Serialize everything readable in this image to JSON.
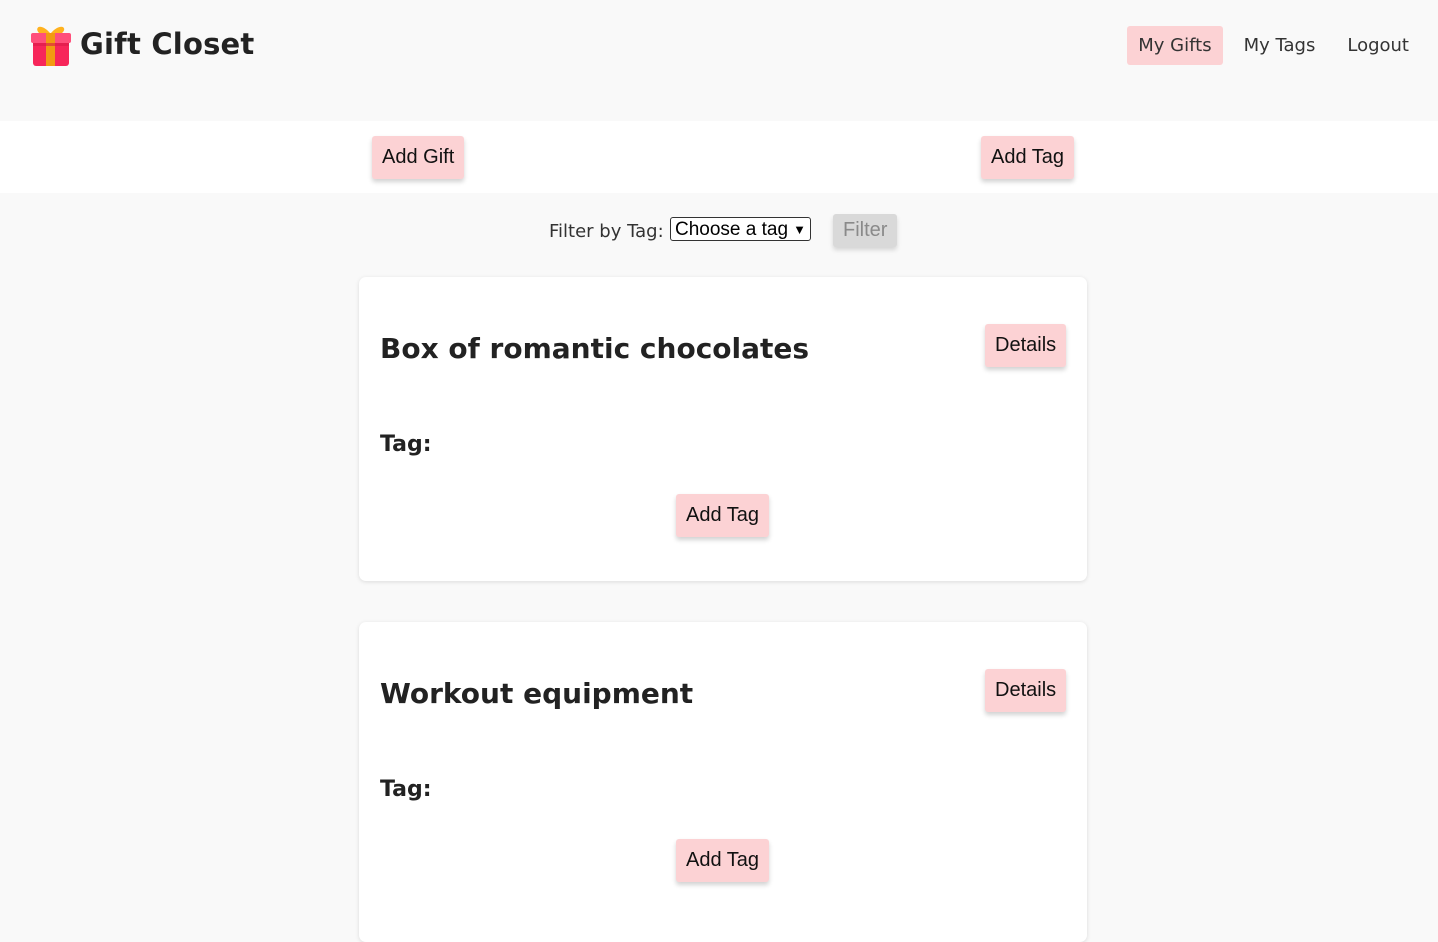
{
  "header": {
    "brand_title": "Gift Closet",
    "brand_icon": "gift-icon",
    "nav": [
      {
        "label": "My Gifts",
        "active": true
      },
      {
        "label": "My Tags",
        "active": false
      },
      {
        "label": "Logout",
        "active": false
      }
    ]
  },
  "actions": {
    "add_gift_label": "Add Gift",
    "add_tag_label": "Add Tag"
  },
  "filter": {
    "label": "Filter by Tag:",
    "select_value": "Choose a tag",
    "button_label": "Filter"
  },
  "gifts": [
    {
      "title": "Box of romantic chocolates",
      "details_label": "Details",
      "tag_label": "Tag:",
      "add_tag_label": "Add Tag"
    },
    {
      "title": "Workout equipment",
      "details_label": "Details",
      "tag_label": "Tag:",
      "add_tag_label": "Add Tag"
    }
  ],
  "colors": {
    "accent_pink": "#fcd2d4",
    "page_background": "#f9f9f9",
    "card_background": "#ffffff"
  }
}
